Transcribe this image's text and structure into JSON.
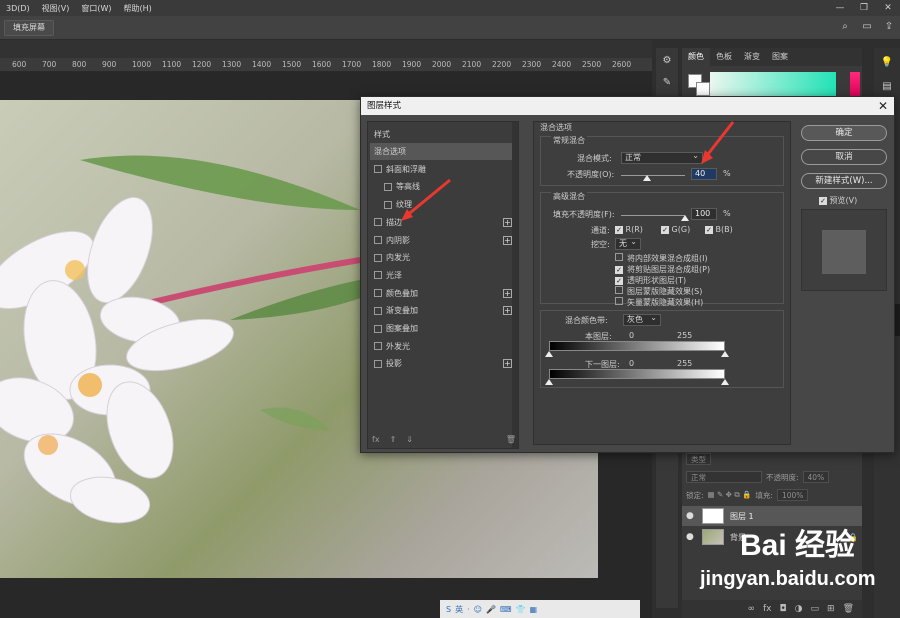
{
  "menubar": {
    "items": [
      "3D(D)",
      "视图(V)",
      "窗口(W)",
      "帮助(H)"
    ],
    "window_controls": [
      "—",
      "❐",
      "✕"
    ]
  },
  "options_bar": {
    "fill_screen_label": "填充屏幕"
  },
  "ruler": {
    "ticks": [
      "600",
      "700",
      "800",
      "900",
      "1000",
      "1100",
      "1200",
      "1300",
      "1400",
      "1500",
      "1600",
      "1700",
      "1800",
      "1900",
      "2000",
      "2100",
      "2200",
      "2300",
      "2400",
      "2500",
      "2600"
    ]
  },
  "panel_tabs": [
    "颜色",
    "色板",
    "渐变",
    "图案"
  ],
  "layers_panel": {
    "kind_label": "类型",
    "blend_value": "正常",
    "opacity_label": "不透明度:",
    "opacity_value": "40%",
    "lock_label": "锁定:",
    "fill_label": "填充:",
    "fill_value": "100%",
    "layers": [
      {
        "name": "图层 1"
      },
      {
        "name": "背景"
      }
    ]
  },
  "watermark": {
    "logo": "Bai 经验",
    "url": "jingyan.baidu.com"
  },
  "taskbar": {
    "items": [
      "S",
      "英",
      "·",
      "☺",
      "🎤",
      "⌨",
      "👕",
      "▦"
    ]
  },
  "dialog": {
    "title": "图层样式",
    "close": "✕",
    "style_list": {
      "header": "样式",
      "items": [
        {
          "label": "混合选项",
          "selected": true,
          "checkbox": false,
          "plus": false,
          "indent": 0
        },
        {
          "label": "斜面和浮雕",
          "checkbox": true,
          "plus": false,
          "indent": 0
        },
        {
          "label": "等高线",
          "checkbox": true,
          "plus": false,
          "indent": 1
        },
        {
          "label": "纹理",
          "checkbox": true,
          "plus": false,
          "indent": 1
        },
        {
          "label": "描边",
          "checkbox": true,
          "plus": true,
          "indent": 0
        },
        {
          "label": "内阴影",
          "checkbox": true,
          "plus": true,
          "indent": 0
        },
        {
          "label": "内发光",
          "checkbox": true,
          "plus": false,
          "indent": 0
        },
        {
          "label": "光泽",
          "checkbox": true,
          "plus": false,
          "indent": 0
        },
        {
          "label": "颜色叠加",
          "checkbox": true,
          "plus": true,
          "indent": 0
        },
        {
          "label": "渐变叠加",
          "checkbox": true,
          "plus": true,
          "indent": 0
        },
        {
          "label": "图案叠加",
          "checkbox": true,
          "plus": false,
          "indent": 0
        },
        {
          "label": "外发光",
          "checkbox": true,
          "plus": false,
          "indent": 0
        },
        {
          "label": "投影",
          "checkbox": true,
          "plus": true,
          "indent": 0
        }
      ],
      "footer": [
        "fx",
        "⇑",
        "⇓",
        "🗑"
      ]
    },
    "blend_options": {
      "section_title": "混合选项",
      "general_title": "常规混合",
      "blend_mode_label": "混合模式:",
      "blend_mode_value": "正常",
      "opacity_label": "不透明度(O):",
      "opacity_value": "40",
      "opacity_unit": "%",
      "opacity_fraction": 0.4,
      "advanced_title": "高级混合",
      "fill_opacity_label": "填充不透明度(F):",
      "fill_opacity_value": "100",
      "fill_opacity_unit": "%",
      "channels_label": "通道:",
      "channels": [
        "R(R)",
        "G(G)",
        "B(B)"
      ],
      "knockout_label": "挖空:",
      "knockout_value": "无",
      "options": [
        {
          "label": "将内部效果混合成组(I)",
          "checked": false
        },
        {
          "label": "将剪贴图层混合成组(P)",
          "checked": true
        },
        {
          "label": "透明形状图层(T)",
          "checked": true
        },
        {
          "label": "图层蒙版隐藏效果(S)",
          "checked": false
        },
        {
          "label": "矢量蒙版隐藏效果(H)",
          "checked": false
        }
      ],
      "blend_if_label": "混合颜色带:",
      "blend_if_value": "灰色",
      "this_layer_label": "本图层:",
      "this_layer_min": "0",
      "this_layer_max": "255",
      "underlying_label": "下一图层:",
      "underlying_min": "0",
      "underlying_max": "255"
    },
    "buttons": {
      "ok": "确定",
      "cancel": "取消",
      "new_style": "新建样式(W)...",
      "preview_label": "预览(V)"
    }
  },
  "colors": {
    "annotation_red": "#e8382f",
    "accent_teal": "#22e3b6",
    "hue_pink": "#ff2a7a"
  }
}
